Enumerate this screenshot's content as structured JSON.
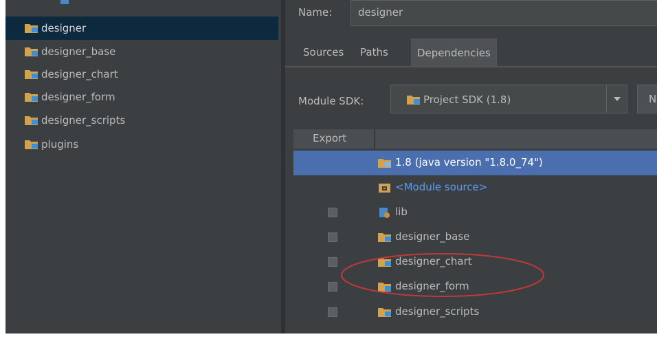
{
  "sidebar": {
    "modules": [
      {
        "label": "designer",
        "icon": "module-folder-icon",
        "selected": true
      },
      {
        "label": "designer_base",
        "icon": "module-folder-icon"
      },
      {
        "label": "designer_chart",
        "icon": "module-folder-icon"
      },
      {
        "label": "designer_form",
        "icon": "module-folder-icon"
      },
      {
        "label": "designer_scripts",
        "icon": "module-folder-icon"
      },
      {
        "label": "plugins",
        "icon": "module-folder-icon"
      }
    ]
  },
  "main": {
    "name_label": "Name:",
    "name_value": "designer",
    "tabs": [
      {
        "label": "Sources"
      },
      {
        "label": "Paths"
      },
      {
        "label": "Dependencies",
        "active": true
      }
    ],
    "module_sdk_label": "Module SDK:",
    "module_sdk_value": "Project SDK (1.8)",
    "new_button_label": "N",
    "table": {
      "export_header": "Export",
      "rows": [
        {
          "label": "1.8 (java version \"1.8.0_74\")",
          "icon": "sdk-folder-icon",
          "checkbox": false,
          "selected": true
        },
        {
          "label": "<Module source>",
          "icon": "source-folder-icon",
          "checkbox": false,
          "link": true
        },
        {
          "label": "lib",
          "icon": "library-icon",
          "checkbox": true
        },
        {
          "label": "designer_base",
          "icon": "module-folder-icon",
          "checkbox": true
        },
        {
          "label": "designer_chart",
          "icon": "module-folder-icon",
          "checkbox": true
        },
        {
          "label": "designer_form",
          "icon": "module-folder-icon",
          "checkbox": true
        },
        {
          "label": "designer_scripts",
          "icon": "module-folder-icon",
          "checkbox": true
        }
      ]
    }
  },
  "colors": {
    "background": "#3c3f41",
    "selection_left": "#0d293e",
    "selection_table": "#4b6eaf",
    "link": "#589df6",
    "annotation": "#c0393b"
  }
}
